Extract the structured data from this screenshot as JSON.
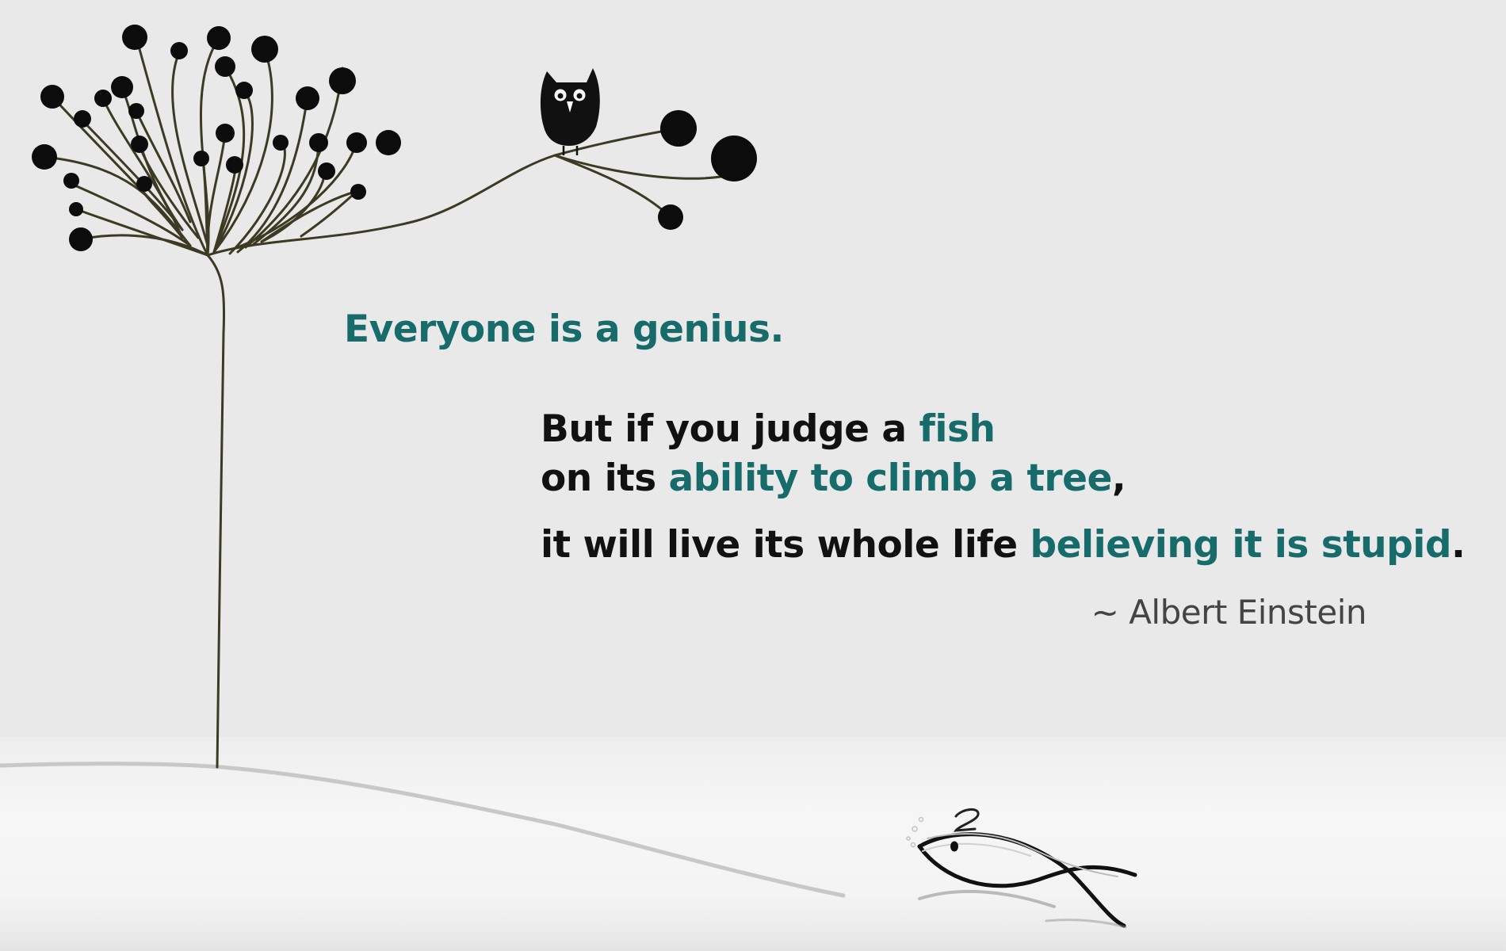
{
  "colors": {
    "background": "#e9e9e9",
    "ground": "#f7f7f7",
    "accent_teal": "#176b6b",
    "text_dark": "#111111",
    "attribution": "#444444",
    "branch": "#3c3a22",
    "berry": "#0c0c0c"
  },
  "quote": {
    "headline": "Everyone is a genius.",
    "line1": {
      "a": "But if you judge a ",
      "b": "fish"
    },
    "line2": {
      "a": "on its ",
      "b": "ability to climb a tree",
      "c": ","
    },
    "line3": {
      "a": "it will live its whole life ",
      "b": "believing it is stupid",
      "c": "."
    }
  },
  "attribution": "~ Albert Einstein",
  "icons": [
    "tree-illustration",
    "owl-icon",
    "fish-icon"
  ]
}
